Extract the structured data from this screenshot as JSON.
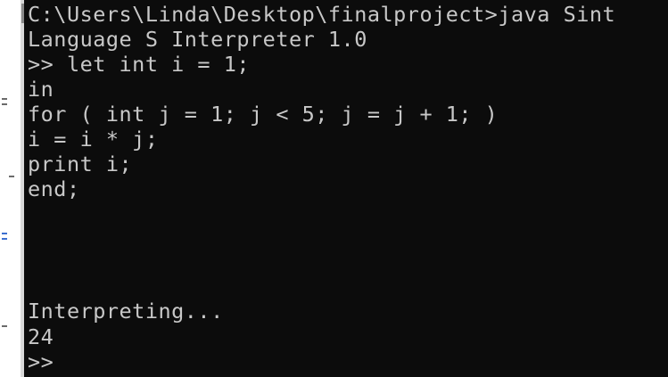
{
  "console": {
    "lines": [
      "C:\\Users\\Linda\\Desktop\\finalproject>java Sint",
      "Language S Interpreter 1.0",
      ">> let int i = 1;",
      "in",
      "for ( int j = 1; j < 5; j = j + 1; )",
      "i = i * j;",
      "print i;",
      "end;",
      "",
      "",
      "Interpreting...",
      "24",
      ">>"
    ]
  },
  "colors": {
    "background": "#0c0c0c",
    "text": "#c8c8c8"
  }
}
